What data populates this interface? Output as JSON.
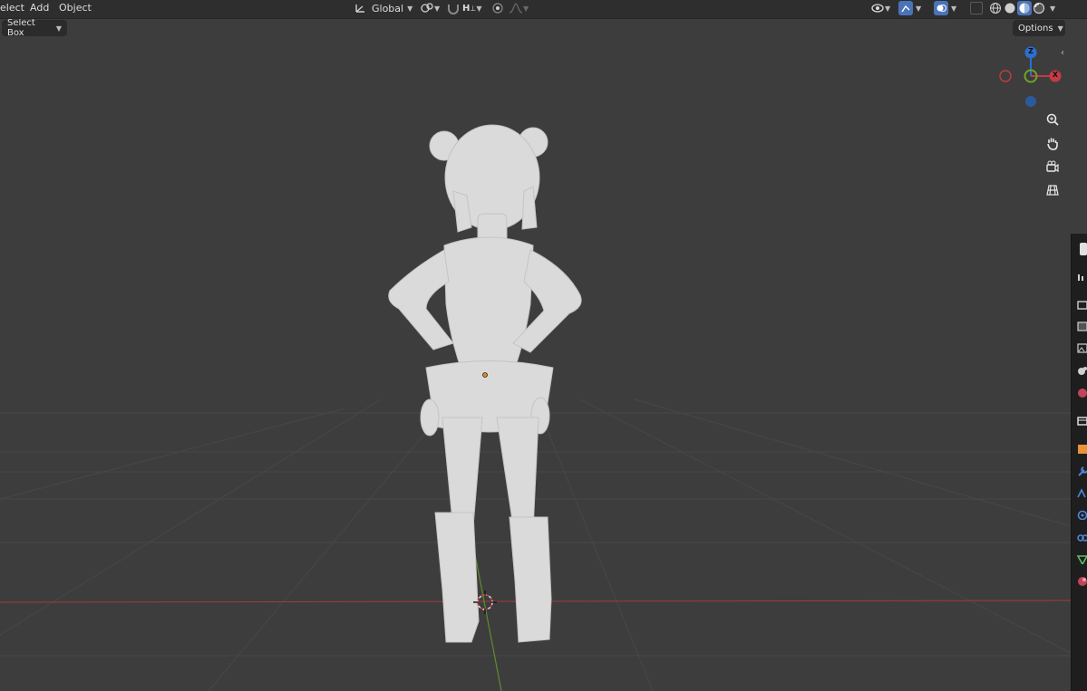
{
  "header": {
    "menu": [
      "elect",
      "Add",
      "Object"
    ],
    "transform_orientation": "Global",
    "snap_label": "H",
    "shading_modes": [
      "wireframe",
      "solid",
      "material-preview",
      "rendered"
    ],
    "active_shading": "material-preview"
  },
  "toolbar": {
    "select_mode": "Select Box",
    "options_label": "Options"
  },
  "gizmo": {
    "z_label": "Z",
    "x_label": "X"
  },
  "nav_icons": [
    "zoom-icon",
    "hand-pan-icon",
    "camera-icon",
    "perspective-grid-icon"
  ],
  "properties_tabs": [
    "tool",
    "render",
    "output",
    "view-layer",
    "scene",
    "world",
    "collection",
    "object",
    "modifiers",
    "particles",
    "physics",
    "constraints",
    "data",
    "material"
  ],
  "colors": {
    "viewport_bg": "#3d3d3d",
    "header_bg": "#2e2e2e",
    "x_axis": "#c43b45",
    "y_axis": "#6fa526",
    "z_axis": "#2c6fd1",
    "model": "#dcdcdc"
  }
}
